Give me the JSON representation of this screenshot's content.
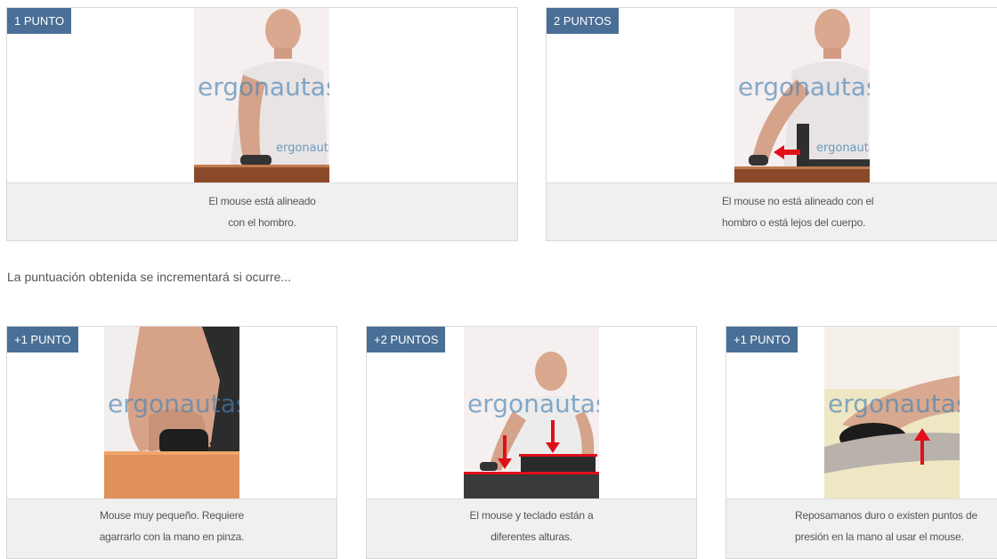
{
  "top_cards": [
    {
      "badge": "1 PUNTO",
      "line1": "El mouse está alineado",
      "line2": "con el hombro.",
      "watermark": "ergonautas"
    },
    {
      "badge": "2 PUNTOS",
      "line1": "El mouse no está alineado con el",
      "line2": "hombro o está lejos del cuerpo.",
      "watermark": "ergonautas"
    }
  ],
  "intro_text": "La puntuación obtenida se incrementará si ocurre...",
  "bottom_cards": [
    {
      "badge": "+1 PUNTO",
      "line1": "Mouse muy pequeño. Requiere",
      "line2": "agarrarlo con la mano en pinza.",
      "watermark": "ergonautas"
    },
    {
      "badge": "+2 PUNTOS",
      "line1": "El mouse y teclado están a",
      "line2": "diferentes alturas.",
      "watermark": "ergonautas"
    },
    {
      "badge": "+1 PUNTO",
      "line1": "Reposamanos duro o existen puntos de",
      "line2": "presión en la mano al usar el mouse.",
      "watermark": "ergonautas"
    }
  ],
  "colors": {
    "badge": "#4a6f96",
    "caption_bg": "#f0f0f0",
    "arrow": "#e0101a",
    "watermark": "#4682b4"
  }
}
